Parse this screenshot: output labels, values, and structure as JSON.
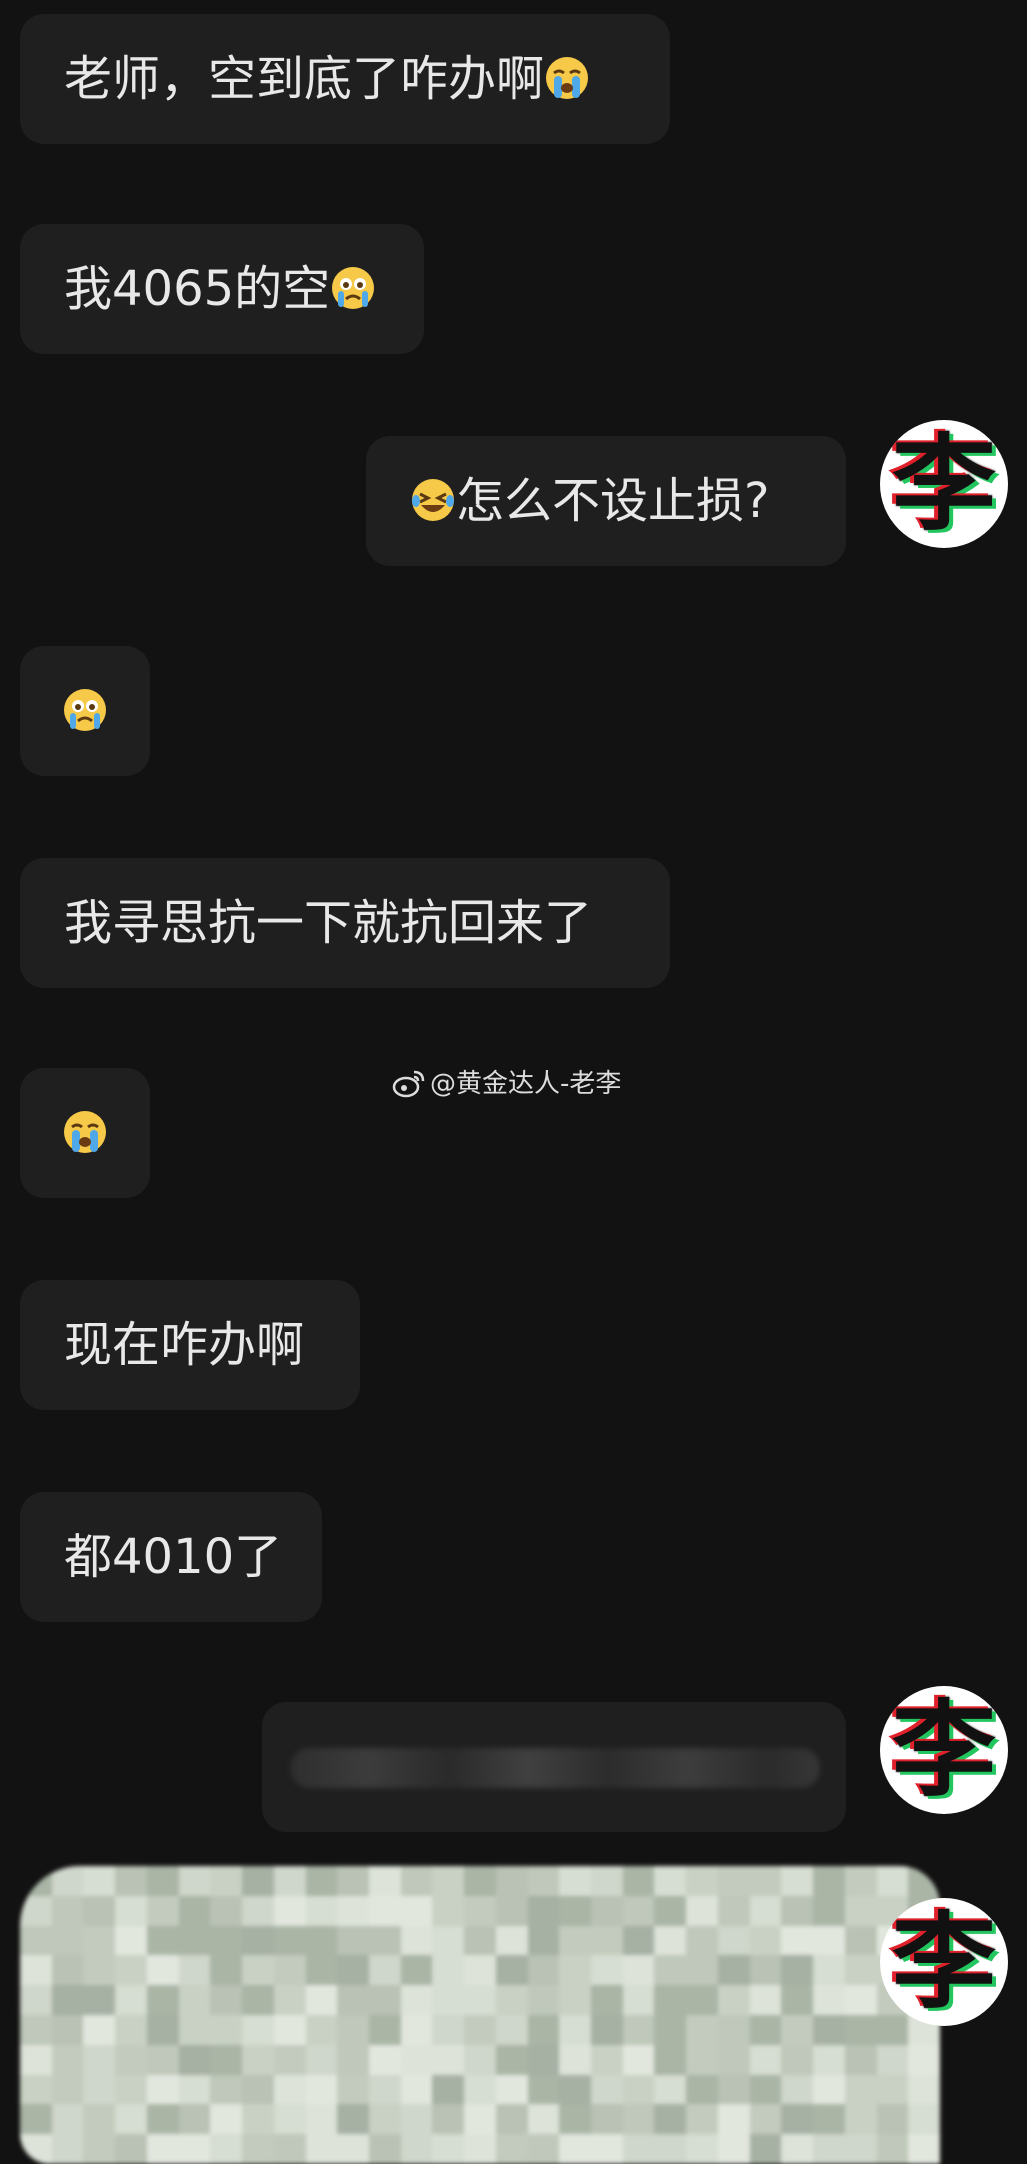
{
  "messages": [
    {
      "side": "left",
      "text": "老师，空到底了咋办啊",
      "emoji": "sob",
      "emoji_position": "end"
    },
    {
      "side": "left",
      "text": "我4065的空",
      "emoji": "crying",
      "emoji_position": "end"
    },
    {
      "side": "right",
      "text": "怎么不设止损?",
      "emoji": "laugh-cry",
      "emoji_position": "start"
    },
    {
      "side": "left",
      "text": "",
      "emoji": "crying"
    },
    {
      "side": "left",
      "text": "我寻思抗一下就抗回来了"
    },
    {
      "side": "left",
      "text": "",
      "emoji": "sob"
    },
    {
      "side": "left",
      "text": "现在咋办啊"
    },
    {
      "side": "left",
      "text": "都4010了"
    }
  ],
  "avatar_char": "李",
  "watermark": "@黄金达人-老李",
  "colors": {
    "background": "#121212",
    "bubble": "#1f1f1f",
    "text": "#e8e8e8"
  }
}
